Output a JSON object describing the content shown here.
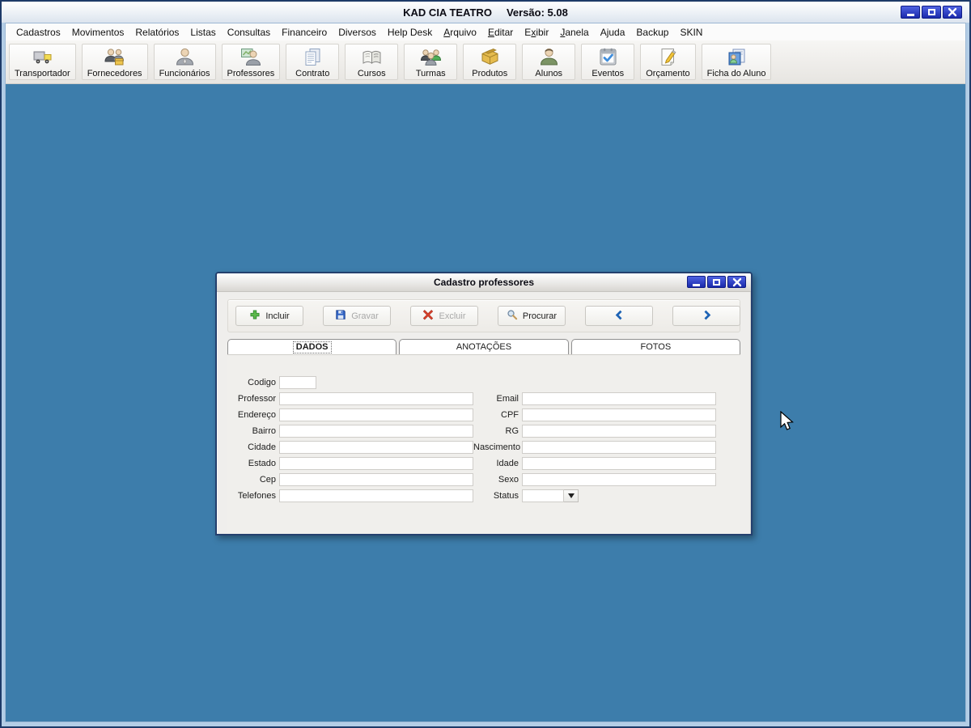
{
  "window": {
    "title": "KAD CIA TEATRO",
    "version_label": "Versão: 5.08",
    "controls": [
      {
        "icon": "minimize-icon"
      },
      {
        "icon": "maximize-icon"
      },
      {
        "icon": "close-icon"
      }
    ]
  },
  "menu": {
    "items": [
      {
        "label": "Cadastros",
        "accel_index": -1
      },
      {
        "label": "Movimentos",
        "accel_index": -1
      },
      {
        "label": "Relatórios",
        "accel_index": -1
      },
      {
        "label": "Listas",
        "accel_index": -1
      },
      {
        "label": "Consultas",
        "accel_index": -1
      },
      {
        "label": "Financeiro",
        "accel_index": -1
      },
      {
        "label": "Diversos",
        "accel_index": -1
      },
      {
        "label": "Help Desk",
        "accel_index": -1
      },
      {
        "label": "Arquivo",
        "accel_index": 0
      },
      {
        "label": "Editar",
        "accel_index": 0
      },
      {
        "label": "Exibir",
        "accel_index": 1
      },
      {
        "label": "Janela",
        "accel_index": 0
      },
      {
        "label": "Ajuda",
        "accel_index": -1
      },
      {
        "label": "Backup",
        "accel_index": -1
      },
      {
        "label": "SKIN",
        "accel_index": -1
      }
    ]
  },
  "toolbar": {
    "buttons": [
      {
        "label": "Transportador",
        "icon": "truck-icon"
      },
      {
        "label": "Fornecedores",
        "icon": "suppliers-icon"
      },
      {
        "label": "Funcionários",
        "icon": "employee-icon"
      },
      {
        "label": "Professores",
        "icon": "teacher-icon"
      },
      {
        "label": "Contrato",
        "icon": "contract-icon"
      },
      {
        "label": "Cursos",
        "icon": "book-icon"
      },
      {
        "label": "Turmas",
        "icon": "group-icon"
      },
      {
        "label": "Produtos",
        "icon": "box-icon"
      },
      {
        "label": "Alunos",
        "icon": "student-icon"
      },
      {
        "label": "Eventos",
        "icon": "calendar-check-icon"
      },
      {
        "label": "Orçamento",
        "icon": "note-pencil-icon"
      },
      {
        "label": "Ficha do Aluno",
        "icon": "student-card-icon"
      }
    ]
  },
  "dialog": {
    "title": "Cadastro professores",
    "controls": [
      {
        "icon": "minimize-icon"
      },
      {
        "icon": "maximize-icon"
      },
      {
        "icon": "close-icon"
      }
    ],
    "toolbar": [
      {
        "label": "Incluir",
        "icon": "plus-icon",
        "enabled": true
      },
      {
        "label": "Gravar",
        "icon": "save-icon",
        "enabled": false
      },
      {
        "label": "Excluir",
        "icon": "delete-icon",
        "enabled": false
      },
      {
        "label": "Procurar",
        "icon": "search-icon",
        "enabled": true
      },
      {
        "label": "",
        "icon": "chevron-left-icon",
        "enabled": true
      },
      {
        "label": "",
        "icon": "chevron-right-icon",
        "enabled": true
      }
    ],
    "tabs": [
      {
        "label": "DADOS",
        "active": true
      },
      {
        "label": "ANOTAÇÕES",
        "active": false
      },
      {
        "label": "FOTOS",
        "active": false
      }
    ],
    "form": {
      "rows": [
        {
          "left_label": "Codigo",
          "left_value": "",
          "right_label": "",
          "right_value": ""
        },
        {
          "left_label": "Professor",
          "left_value": "",
          "right_label": "Email",
          "right_value": ""
        },
        {
          "left_label": "Endereço",
          "left_value": "",
          "right_label": "CPF",
          "right_value": ""
        },
        {
          "left_label": "Bairro",
          "left_value": "",
          "right_label": "RG",
          "right_value": ""
        },
        {
          "left_label": "Cidade",
          "left_value": "",
          "right_label": "Nascimento",
          "right_value": ""
        },
        {
          "left_label": "Estado",
          "left_value": "",
          "right_label": "Idade",
          "right_value": ""
        },
        {
          "left_label": "Cep",
          "left_value": "",
          "right_label": "Sexo",
          "right_value": ""
        },
        {
          "left_label": "Telefones",
          "left_value": "",
          "right_label": "Status",
          "right_value": ""
        }
      ]
    }
  },
  "colors": {
    "desktop_blue": "#3d7dab",
    "caption_button_blue": "#1a2aac",
    "accent_chevron_blue": "#1e63b5",
    "disabled_text": "#a8a8a8",
    "dialog_bg": "#efeeec",
    "frame_light_blue": "#b3cde6",
    "frame_dark_navy": "#1d3a68"
  }
}
